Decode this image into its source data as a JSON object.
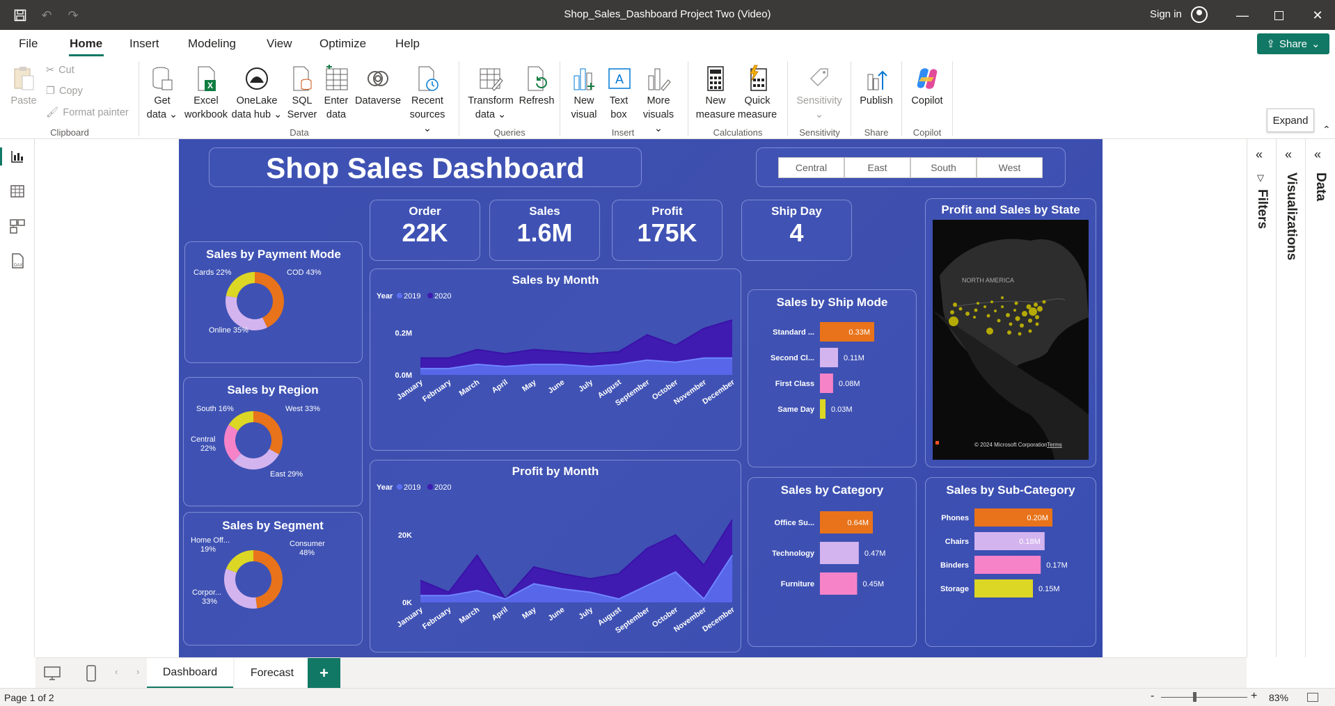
{
  "window": {
    "title": "Shop_Sales_Dashboard Project Two (Video)",
    "sign_in": "Sign in"
  },
  "menu": {
    "items": [
      "File",
      "Home",
      "Insert",
      "Modeling",
      "View",
      "Optimize",
      "Help"
    ],
    "active": "Home",
    "share": "Share"
  },
  "ribbon": {
    "clipboard": {
      "paste": "Paste",
      "cut": "Cut",
      "copy": "Copy",
      "format_painter": "Format painter",
      "group": "Clipboard"
    },
    "data": {
      "get_data": [
        "Get",
        "data"
      ],
      "excel": [
        "Excel",
        "workbook"
      ],
      "onelake": [
        "OneLake",
        "data hub"
      ],
      "sql": [
        "SQL",
        "Server"
      ],
      "enter": [
        "Enter",
        "data"
      ],
      "dataverse": "Dataverse",
      "recent": [
        "Recent",
        "sources"
      ],
      "group": "Data"
    },
    "queries": {
      "transform": [
        "Transform",
        "data"
      ],
      "refresh": "Refresh",
      "group": "Queries"
    },
    "insert": {
      "new_visual": [
        "New",
        "visual"
      ],
      "text_box": [
        "Text",
        "box"
      ],
      "more_visuals": [
        "More",
        "visuals"
      ],
      "group": "Insert"
    },
    "calculations": {
      "new_measure": [
        "New",
        "measure"
      ],
      "quick_measure": [
        "Quick",
        "measure"
      ],
      "group": "Calculations"
    },
    "sensitivity": {
      "label": "Sensitivity",
      "group": "Sensitivity"
    },
    "share": {
      "publish": "Publish",
      "group": "Share"
    },
    "copilot": {
      "label": "Copilot",
      "group": "Copilot"
    }
  },
  "tooltip": "Expand",
  "panes": {
    "filters": "Filters",
    "visualizations": "Visualizations",
    "data": "Data"
  },
  "dashboard": {
    "title": "Shop Sales Dashboard",
    "regions": [
      "Central",
      "East",
      "South",
      "West"
    ],
    "kpis": [
      {
        "label": "Order",
        "value": "22K"
      },
      {
        "label": "Sales",
        "value": "1.6M"
      },
      {
        "label": "Profit",
        "value": "175K"
      },
      {
        "label": "Ship Day",
        "value": "4"
      }
    ],
    "colors": {
      "orange": "#e8731a",
      "lavender": "#d4b4ef",
      "yellow": "#dcd625",
      "pink": "#f683c8",
      "series2019": "#5b6ff0",
      "series2020": "#3f1bb1"
    },
    "map": {
      "title": "Profit and Sales by State",
      "label": "NORTH AMERICA",
      "credit": "© 2024 Microsoft Corporation",
      "terms": "Terms"
    }
  },
  "chart_data": [
    {
      "type": "pie",
      "title": "Sales by Payment Mode",
      "categories": [
        "COD",
        "Online",
        "Cards"
      ],
      "values": [
        43,
        35,
        22
      ],
      "labels": [
        "COD 43%",
        "Online 35%",
        "Cards 22%"
      ]
    },
    {
      "type": "pie",
      "title": "Sales by Region",
      "categories": [
        "West",
        "East",
        "Central",
        "South"
      ],
      "values": [
        33,
        29,
        22,
        16
      ],
      "labels": [
        "West 33%",
        "East 29%",
        "Central 22%",
        "South 16%"
      ]
    },
    {
      "type": "pie",
      "title": "Sales by Segment",
      "categories": [
        "Consumer",
        "Corporate",
        "Home Office"
      ],
      "values": [
        48,
        33,
        19
      ],
      "labels": [
        "Consumer 48%",
        "Corpor... 33%",
        "Home Off... 19%"
      ]
    },
    {
      "type": "area",
      "title": "Sales by Month",
      "legend_title": "Year",
      "categories": [
        "January",
        "February",
        "March",
        "April",
        "May",
        "June",
        "July",
        "August",
        "September",
        "October",
        "November",
        "December"
      ],
      "series": [
        {
          "name": "2019",
          "values": [
            0.03,
            0.03,
            0.05,
            0.04,
            0.05,
            0.05,
            0.04,
            0.05,
            0.07,
            0.06,
            0.08,
            0.08
          ]
        },
        {
          "name": "2020",
          "values": [
            0.08,
            0.08,
            0.12,
            0.1,
            0.12,
            0.11,
            0.1,
            0.11,
            0.19,
            0.14,
            0.22,
            0.26
          ]
        }
      ],
      "yticks": [
        "0.0M",
        "0.2M"
      ],
      "ylim": [
        0,
        0.27
      ]
    },
    {
      "type": "area",
      "title": "Profit by Month",
      "legend_title": "Year",
      "categories": [
        "January",
        "February",
        "March",
        "April",
        "May",
        "June",
        "July",
        "August",
        "September",
        "October",
        "November",
        "December"
      ],
      "series": [
        {
          "name": "2019",
          "values": [
            2000,
            2000,
            3500,
            1000,
            5500,
            4000,
            3000,
            1000,
            5000,
            9000,
            1000,
            14000
          ]
        },
        {
          "name": "2020",
          "values": [
            6500,
            3000,
            14000,
            1000,
            10500,
            8500,
            7000,
            8500,
            16000,
            20000,
            11000,
            24500
          ]
        }
      ],
      "yticks": [
        "0K",
        "20K"
      ],
      "ylim": [
        0,
        26000
      ]
    },
    {
      "type": "bar",
      "title": "Sales by Ship Mode",
      "categories": [
        "Standard ...",
        "Second Cl...",
        "First Class",
        "Same Day"
      ],
      "values": [
        0.33,
        0.11,
        0.08,
        0.03
      ],
      "labels": [
        "0.33M",
        "0.11M",
        "0.08M",
        "0.03M"
      ]
    },
    {
      "type": "bar",
      "title": "Sales by Category",
      "categories": [
        "Office Su...",
        "Technology",
        "Furniture"
      ],
      "values": [
        0.64,
        0.47,
        0.45
      ],
      "labels": [
        "0.64M",
        "0.47M",
        "0.45M"
      ]
    },
    {
      "type": "bar",
      "title": "Sales by Sub-Category",
      "categories": [
        "Phones",
        "Chairs",
        "Binders",
        "Storage"
      ],
      "values": [
        0.2,
        0.18,
        0.17,
        0.15
      ],
      "labels": [
        "0.20M",
        "0.18M",
        "0.17M",
        "0.15M"
      ]
    }
  ],
  "tabs": [
    "Dashboard",
    "Forecast"
  ],
  "status": {
    "page": "Page 1 of 2",
    "zoom": "83%"
  }
}
